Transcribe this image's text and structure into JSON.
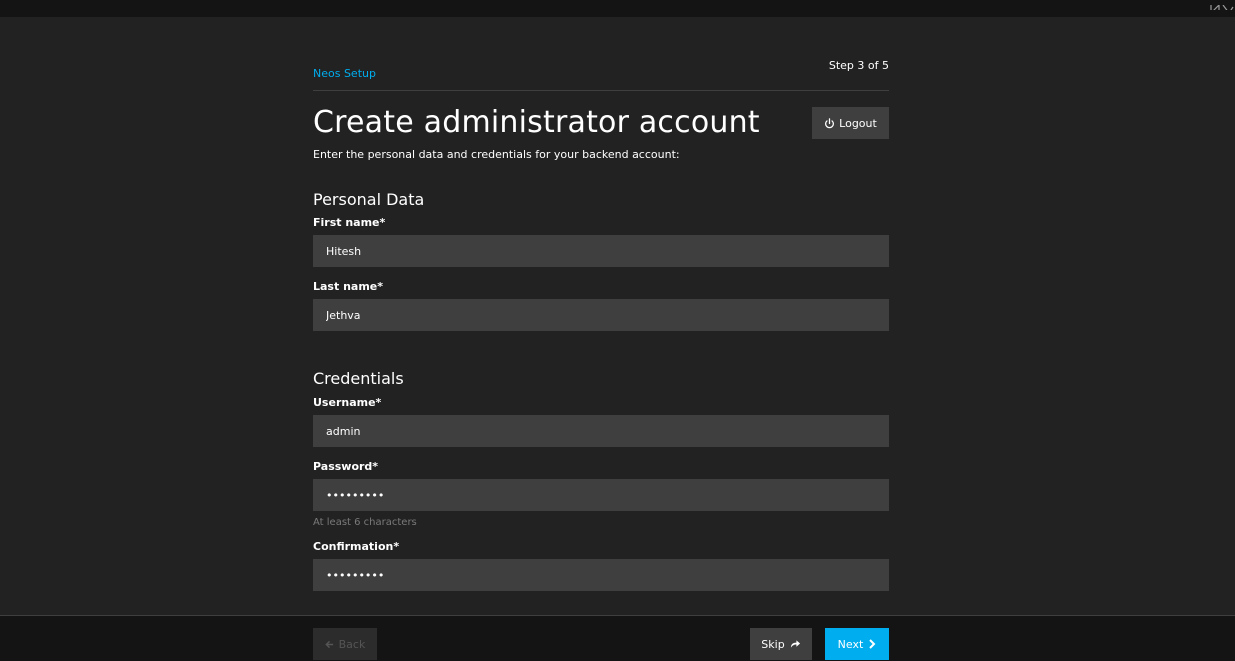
{
  "header": {
    "breadcrumb": "Neos Setup",
    "step": "Step 3 of 5",
    "title": "Create administrator account",
    "logout_label": "Logout",
    "intro": "Enter the personal data and credentials for your backend account:"
  },
  "personal": {
    "section_title": "Personal Data",
    "first_name_label": "First name*",
    "first_name_value": "Hitesh",
    "last_name_label": "Last name*",
    "last_name_value": "Jethva"
  },
  "credentials": {
    "section_title": "Credentials",
    "username_label": "Username*",
    "username_value": "admin",
    "password_label": "Password*",
    "password_value": "•••••••••",
    "password_help": "At least 6 characters",
    "confirmation_label": "Confirmation*",
    "confirmation_value": "•••••••••"
  },
  "footer": {
    "back_label": "Back",
    "skip_label": "Skip",
    "next_label": "Next"
  },
  "icons": {
    "logout": "power-icon",
    "back": "arrow-left-icon",
    "skip": "share-arrow-icon",
    "next": "chevron-right-icon"
  },
  "colors": {
    "background": "#222222",
    "topbar": "#141414",
    "input": "#3f3f3f",
    "accent": "#00adee",
    "help": "#7a7a7a"
  }
}
